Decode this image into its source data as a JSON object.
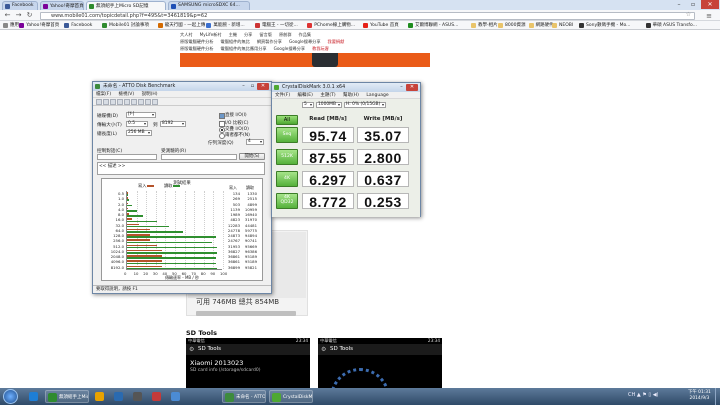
{
  "browser": {
    "tabs": [
      {
        "label": "Facebook",
        "color": "#3b5998"
      },
      {
        "label": "Yahoo!奇摩首頁",
        "color": "#7b0099"
      },
      {
        "label": "無須紹手上Micro SD記憶",
        "color": "#2f8b2f"
      },
      {
        "label": "SAMSUNG microSDXC 64...",
        "color": "#1e4fb5"
      }
    ],
    "url": "www.mobile01.com/topicdetail.php?f=495&t=3461819&p=62",
    "bookmarks": [
      {
        "label": "應用",
        "color": "#888888"
      },
      {
        "label": "Yahoo!奇摩首頁",
        "color": "#7b0099"
      },
      {
        "label": "Facebook",
        "color": "#3b5998"
      },
      {
        "label": "Mobile01 討論事項",
        "color": "#2f8b2f"
      },
      {
        "label": "龍天行國 - 一起上傳",
        "color": "#d46a00"
      },
      {
        "label": "萬能腕 - 新增...",
        "color": "#3a6fcf"
      },
      {
        "label": "電腦王 - 一切從...",
        "color": "#cc3333"
      },
      {
        "label": "PChome線上購物...",
        "color": "#d33"
      },
      {
        "label": "YouTube 首頁",
        "color": "#e62117"
      },
      {
        "label": "艾爾博聯網 - ASUS...",
        "color": "#1e8c1e"
      },
      {
        "label": "教學-相片",
        "color": "#e9c46a"
      },
      {
        "label": "8000資源",
        "color": "#e9c46a"
      },
      {
        "label": "網路硬件",
        "color": "#e9c46a"
      },
      {
        "label": "NEOBI",
        "color": "#e9c46a"
      },
      {
        "label": "Sony數碼手機 - Mo...",
        "color": "#333333"
      },
      {
        "label": "華碩 ASUS Transfo...",
        "color": "#333333"
      }
    ]
  },
  "webpage": {
    "nav_rows": [
      [
        "大人村",
        "MyLife新村",
        "主機",
        "分享",
        "留言版",
        "原創群",
        "作品集"
      ],
      [
        "原版電腦硬件分析",
        "電腦組件的無比",
        "網頁製作分享",
        "Google搜尋分享",
        "我要捐獻"
      ],
      [
        "原版電腦硬件分析",
        "電腦組件的無比應用分享",
        "Google搜尋分享",
        "教我玩客"
      ]
    ],
    "capacity_text": "可用 746MB  總共 854MB",
    "sd_tools_heading": "SD Tools",
    "phone1": {
      "carrier": "中華電信",
      "time": "23:34",
      "app": "SD Tools",
      "device": "Xiaomi 2013023",
      "path": "SD card info (/storage/sdcard0)"
    },
    "phone2": {
      "carrier": "中華電信",
      "time": "23:34",
      "app": "SD Tools"
    }
  },
  "atto": {
    "title": "未命名 - ATTO Disk Benchmark",
    "menu": [
      "檔案(F)",
      "檢視(V)",
      "說明(H)"
    ],
    "drive_label": "磁碟機(D)",
    "drive_value": "[f-]",
    "transfer_label": "傳輸大小(T)",
    "transfer_from": "0.5",
    "transfer_to": "8192",
    "total_label": "總長度(L)",
    "total_value": "256 MB",
    "direct_io": "直接 I/O(I)",
    "io_compare": "I/O 比較(C)",
    "overlapped": "交疊 I/O(O)",
    "neither": "兩者都不(N)",
    "queue_label": "佇列深度(Q)",
    "queue_value": "4",
    "control_label": "控制對話(C)",
    "tester_label": "受測驗的(R)",
    "start_button": "開始(S)",
    "description": "<< 描述 >>",
    "chart_title": "測試結果",
    "write_label": "寫入",
    "read_label": "讀取",
    "write_col": "寫入",
    "read_col": "讀取",
    "x_axis": "傳輸速率 - MB / 秒",
    "status": "要取得說明，請按 F1"
  },
  "chart_data": {
    "type": "bar",
    "title": "測試結果",
    "xlabel": "傳輸速率 - MB / 秒",
    "xlim": [
      0,
      100
    ],
    "xticks": [
      "0",
      "10",
      "20",
      "30",
      "40",
      "50",
      "60",
      "70",
      "80",
      "90",
      "100"
    ],
    "categories": [
      "0.5",
      "1.0",
      "2.0",
      "4.0",
      "8.0",
      "16.0",
      "32.0",
      "64.0",
      "128.0",
      "256.0",
      "512.0",
      "1024.0",
      "2048.0",
      "4096.0",
      "8192.0"
    ],
    "series": [
      {
        "name": "寫入",
        "color": "#b5532a",
        "values": [
          134,
          269,
          503,
          1139,
          1989,
          4823,
          12283,
          24778,
          24873,
          24767,
          31953,
          36827,
          36861,
          36861,
          36899
        ],
        "unit": "KB/s"
      },
      {
        "name": "讀取",
        "color": "#2f8f2f",
        "values": [
          1330,
          2515,
          4899,
          10959,
          16940,
          31970,
          44481,
          59775,
          94894,
          90741,
          95669,
          96386,
          95189,
          95189,
          95821
        ],
        "unit": "KB/s"
      }
    ]
  },
  "cdm": {
    "title": "CrystalDiskMark 3.0.1 x64",
    "menu": [
      "文件(F)",
      "編輯(E)",
      "主題(T)",
      "幫助(H)",
      "Language"
    ],
    "passes": "5",
    "size": "1000MB",
    "drive": "H: 0% (0/15GB)",
    "all_button": "All",
    "read_header": "Read [MB/s]",
    "write_header": "Write [MB/s]",
    "rows": [
      {
        "label": "Seq",
        "read": "95.74",
        "write": "35.07"
      },
      {
        "label": "512K",
        "read": "87.55",
        "write": "2.800"
      },
      {
        "label": "4K",
        "read": "6.297",
        "write": "0.637"
      },
      {
        "label": "4K QD32",
        "read": "8.772",
        "write": "0.253"
      }
    ]
  },
  "taskbar": {
    "items": [
      {
        "label": "",
        "color": "#1e7ed6"
      },
      {
        "label": "無須紹手上Micro...",
        "color": "#2f8b2f"
      },
      {
        "label": "",
        "color": "#e8a200"
      },
      {
        "label": "",
        "color": "#2a6ab0"
      },
      {
        "label": "",
        "color": "#555555"
      },
      {
        "label": "",
        "color": "#c43a3a"
      },
      {
        "label": "",
        "color": "#4b8bd4"
      },
      {
        "label": "未命名 - ATTO Di...",
        "color": "#3d8b3d"
      },
      {
        "label": "CrystalDiskMark 3...",
        "color": "#4ea832"
      }
    ],
    "tray": "CH ▲ ⚑ ▯ ◀)",
    "time": "下午 01:31",
    "date": "2014/9/3"
  }
}
